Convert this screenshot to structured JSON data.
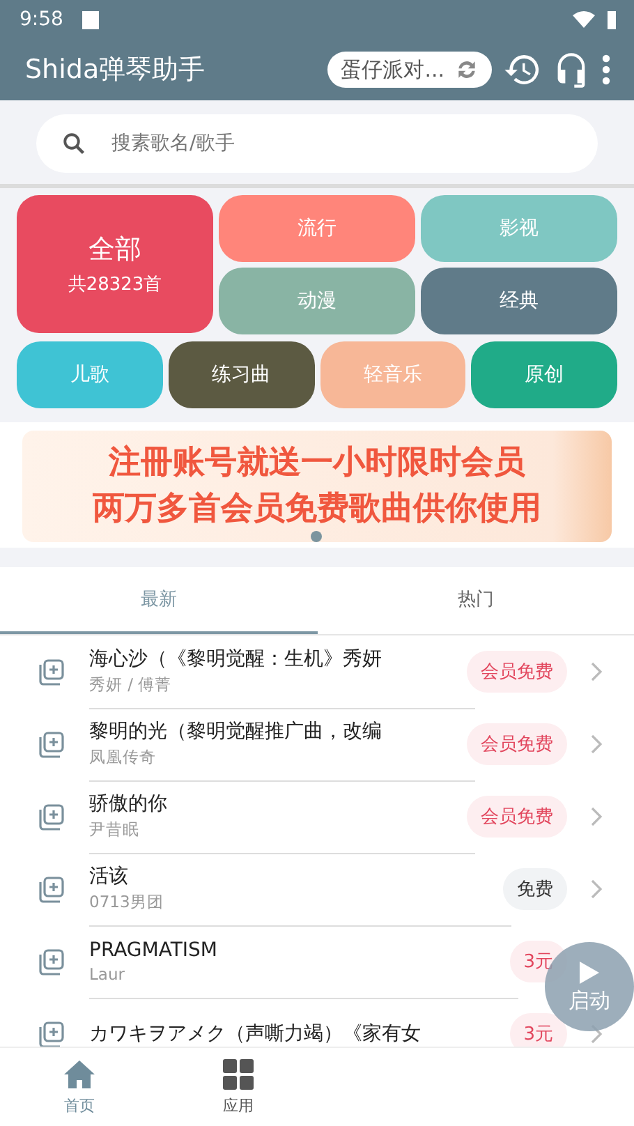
{
  "status_bar": {
    "time": "9:58"
  },
  "toolbar": {
    "title": "Shida弹琴助手",
    "song_chip": "蛋仔派对..."
  },
  "search": {
    "placeholder": "搜素歌名/歌手"
  },
  "categories": {
    "all": {
      "label": "全部",
      "count": "共28323首",
      "color": "#e84b60"
    },
    "tiles": [
      {
        "label": "流行",
        "color": "#ff857a"
      },
      {
        "label": "影视",
        "color": "#7fc7c2"
      },
      {
        "label": "动漫",
        "color": "#89b4a4"
      },
      {
        "label": "经典",
        "color": "#607b89"
      }
    ],
    "row": [
      {
        "label": "儿歌",
        "color": "#3fc3d4"
      },
      {
        "label": "练习曲",
        "color": "#5c5a42"
      },
      {
        "label": "轻音乐",
        "color": "#f7b797"
      },
      {
        "label": "原创",
        "color": "#20ab88"
      }
    ]
  },
  "banner": {
    "lines": [
      "注冊账号就送一小时限时会员",
      "两万多首会员免费歌曲供你使用"
    ]
  },
  "tabs": [
    {
      "label": "最新",
      "selected": true
    },
    {
      "label": "热门",
      "selected": false
    }
  ],
  "songs": [
    {
      "title": "海心沙（《黎明觉醒：生机》秀妍",
      "artist": "秀妍 / 傅菁",
      "badge": "会员免费",
      "kind": "member"
    },
    {
      "title": "黎明的光（黎明觉醒推广曲，改编",
      "artist": "凤凰传奇",
      "badge": "会员免费",
      "kind": "member"
    },
    {
      "title": "骄傲的你",
      "artist": "尹昔眠",
      "badge": "会员免费",
      "kind": "member"
    },
    {
      "title": "活该",
      "artist": "0713男团",
      "badge": "免费",
      "kind": "free"
    },
    {
      "title": "PRAGMATISM",
      "artist": "Laur",
      "badge": "3元",
      "kind": "price"
    },
    {
      "title": "カワキヲアメク（声嘶力竭）《家有女",
      "badge": "3元",
      "kind": "price"
    }
  ],
  "fab": {
    "label": "启动"
  },
  "bottom_nav": [
    {
      "label": "首页",
      "selected": true
    },
    {
      "label": "应用",
      "selected": false
    }
  ]
}
